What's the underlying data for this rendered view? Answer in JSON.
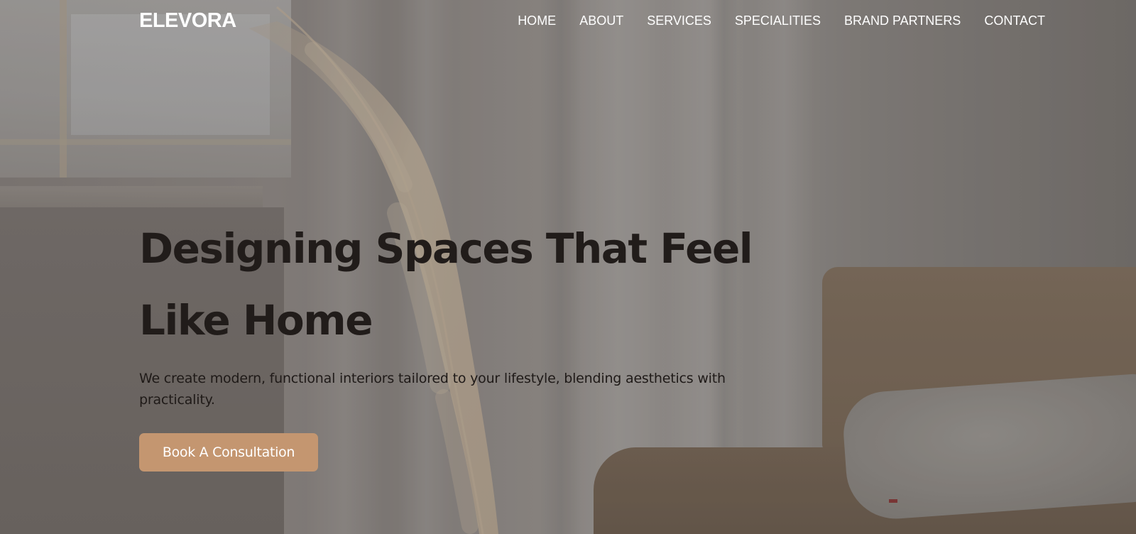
{
  "brand": {
    "logo_text": "ELEVORA"
  },
  "nav": {
    "items": [
      {
        "label": "HOME"
      },
      {
        "label": "ABOUT"
      },
      {
        "label": "SERVICES"
      },
      {
        "label": "SPECIALITIES"
      },
      {
        "label": "BRAND PARTNERS"
      },
      {
        "label": "CONTACT"
      }
    ]
  },
  "hero": {
    "title_line1": "Designing Spaces That Feel",
    "title_line2": "Like Home",
    "subtitle": "We create modern, functional interiors tailored to your lifestyle, blending aesthetics with practicality.",
    "cta_label": "Book A Consultation"
  },
  "colors": {
    "cta_background": "#c49670",
    "heading_text": "#211c1a",
    "nav_text": "#ffffff"
  }
}
